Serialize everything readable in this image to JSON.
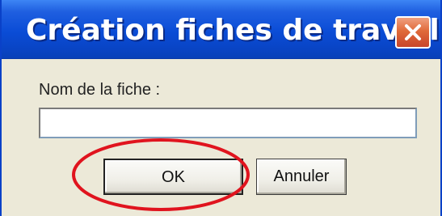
{
  "window": {
    "title": "Création fiches de travail"
  },
  "title_bar_buttons": {
    "close_icon": "close-x-icon"
  },
  "form": {
    "label": "Nom de la fiche :",
    "input_value": ""
  },
  "buttons": {
    "ok_label": "OK",
    "cancel_label": "Annuler"
  },
  "annotation": {
    "shape": "ellipse",
    "target": "OK",
    "color": "#e0141e"
  },
  "colors": {
    "titlebar": "#0a4cd6",
    "dialog_background": "#ece9d8",
    "close_button": "#e06a3a"
  }
}
